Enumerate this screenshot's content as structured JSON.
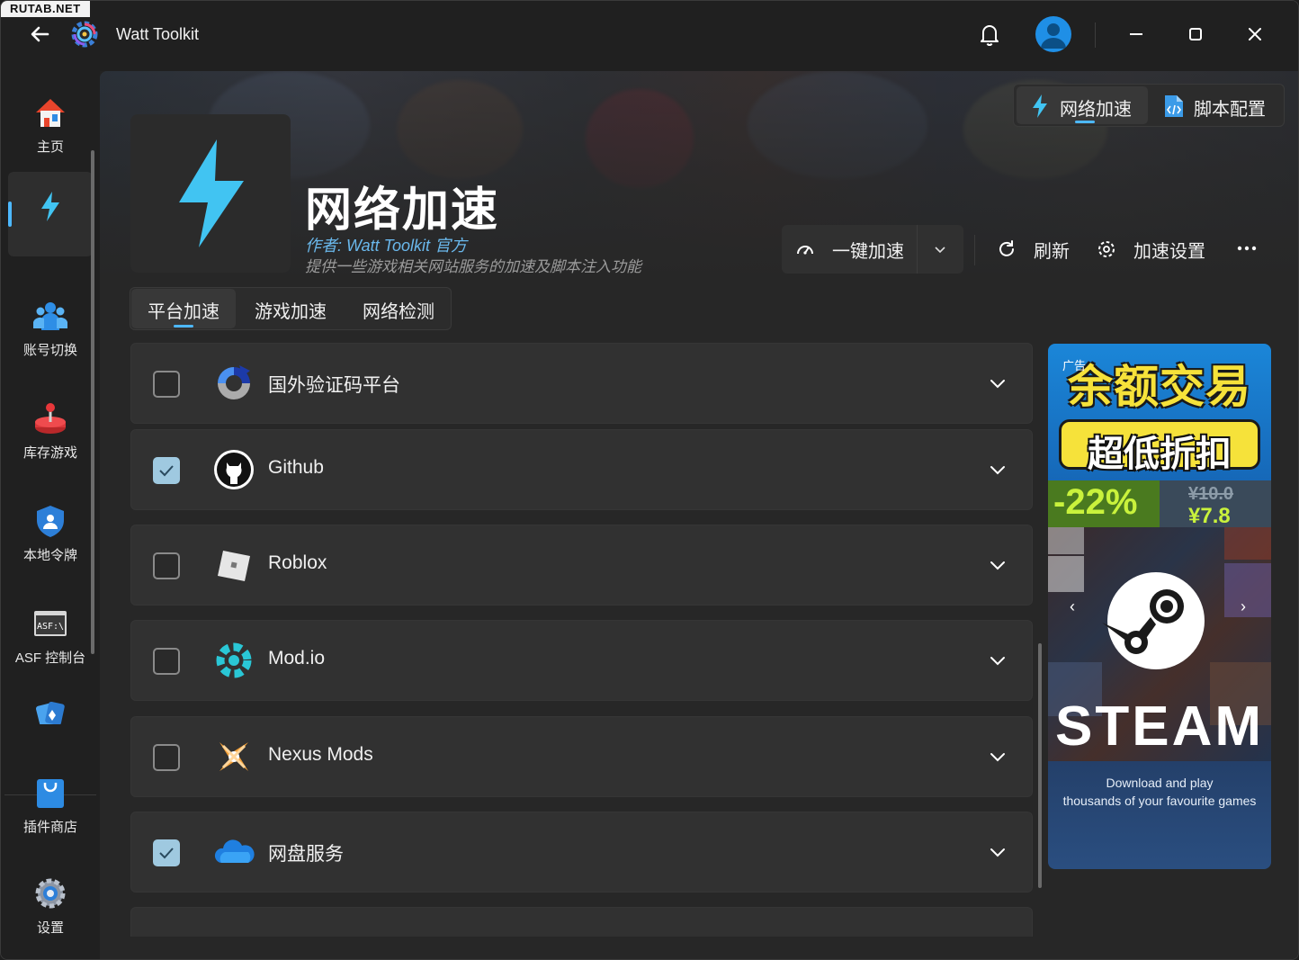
{
  "watermark": "RUTAB.NET",
  "app": {
    "title": "Watt Toolkit"
  },
  "sidebar": {
    "items": [
      {
        "label": "主页",
        "icon": "home-icon"
      },
      {
        "label": "",
        "icon": "lightning-icon",
        "active": true
      },
      {
        "label": "账号切换",
        "icon": "users-icon"
      },
      {
        "label": "库存游戏",
        "icon": "joystick-icon"
      },
      {
        "label": "本地令牌",
        "icon": "shield-user-icon"
      },
      {
        "label": "ASF 控制台",
        "icon": "asf-console-icon",
        "icon_text": "ASF:\\"
      },
      {
        "label": "",
        "icon": "cards-icon"
      },
      {
        "label": "插件商店",
        "icon": "shopping-bag-icon"
      },
      {
        "label": "设置",
        "icon": "gear-icon"
      }
    ]
  },
  "header": {
    "mode_switch": [
      {
        "label": "网络加速",
        "icon": "lightning-icon",
        "active": true
      },
      {
        "label": "脚本配置",
        "icon": "script-file-icon"
      }
    ],
    "plugin_title": "网络加速",
    "author": "作者:  Watt Toolkit  官方",
    "description": "提供一些游戏相关网站服务的加速及脚本注入功能",
    "accelerate_button": "一键加速",
    "refresh": "刷新",
    "settings": "加速设置"
  },
  "tabs": [
    {
      "label": "平台加速",
      "active": true
    },
    {
      "label": "游戏加速"
    },
    {
      "label": "网络检测"
    }
  ],
  "services": [
    {
      "label": "国外验证码平台",
      "checked": false,
      "icon": "recaptcha-icon"
    },
    {
      "label": "Github",
      "checked": true,
      "icon": "github-icon"
    },
    {
      "label": "Roblox",
      "checked": false,
      "icon": "roblox-icon"
    },
    {
      "label": "Mod.io",
      "checked": false,
      "icon": "modio-icon"
    },
    {
      "label": "Nexus Mods",
      "checked": false,
      "icon": "nexus-mods-icon"
    },
    {
      "label": "网盘服务",
      "checked": true,
      "icon": "cloud-drive-icon"
    }
  ],
  "ad": {
    "tag": "广告",
    "headline": "余额交易",
    "subheadline": "超低折扣",
    "discount": "-22%",
    "old_price": "¥10.0",
    "new_price": "¥7.8",
    "brand": "STEAM",
    "tagline_1": "Download and play",
    "tagline_2": "thousands of your favourite games"
  },
  "colors": {
    "accent": "#4db8ff",
    "checkbox_on": "#9fc9e0",
    "ad_yellow": "#f6e23a",
    "ad_green": "#c9f23c"
  }
}
